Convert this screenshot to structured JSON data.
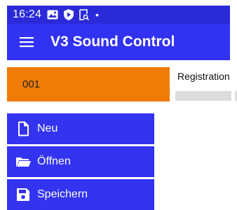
{
  "status_bar": {
    "time": "16:24",
    "icons": [
      "image-icon",
      "shield-play-icon",
      "screenshot-icon",
      "notification-dot-icon"
    ],
    "dot": "•"
  },
  "app_bar": {
    "title": "V3 Sound Control",
    "menu_icon": "hamburger-menu-icon",
    "background": "#3232f2"
  },
  "content": {
    "preset_number": "001",
    "preset_color": "#f07c07",
    "registration_label": "Registration"
  },
  "menu": {
    "items": [
      {
        "label": "Neu",
        "icon": "new-file-icon"
      },
      {
        "label": "Öffnen",
        "icon": "folder-open-icon"
      },
      {
        "label": "Speichern",
        "icon": "save-icon"
      }
    ],
    "background": "#3333f0"
  }
}
